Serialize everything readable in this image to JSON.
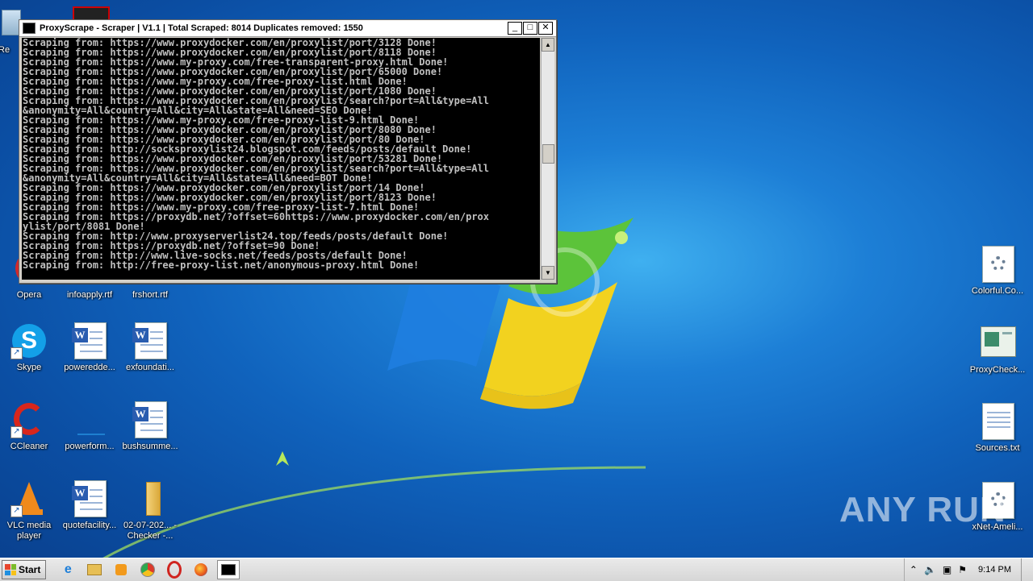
{
  "desktop": {
    "icons_left": [
      {
        "label": "Opera"
      },
      {
        "label": "infoapply.rtf"
      },
      {
        "label": "frshort.rtf"
      },
      {
        "label": "Skype"
      },
      {
        "label": "poweredde..."
      },
      {
        "label": "exfoundati..."
      },
      {
        "label": "CCleaner"
      },
      {
        "label": "powerform..."
      },
      {
        "label": "bushsumme..."
      },
      {
        "label": "VLC media player"
      },
      {
        "label": "quotefacility..."
      },
      {
        "label": "02-07-202... - Checker -..."
      }
    ],
    "icons_right": [
      {
        "label": "Colorful.Co..."
      },
      {
        "label": "ProxyCheck..."
      },
      {
        "label": "Sources.txt"
      },
      {
        "label": "xNet-Ameli..."
      }
    ],
    "partial_labels": {
      "top_left": "Re"
    }
  },
  "window": {
    "title": "ProxyScrape - Scraper | V1.1 | Total Scraped: 8014 Duplicates removed: 1550",
    "console_lines": [
      "Scraping from: https://www.proxydocker.com/en/proxylist/port/3128 Done!",
      "Scraping from: https://www.proxydocker.com/en/proxylist/port/8118 Done!",
      "Scraping from: https://www.my-proxy.com/free-transparent-proxy.html Done!",
      "Scraping from: https://www.proxydocker.com/en/proxylist/port/65000 Done!",
      "Scraping from: https://www.my-proxy.com/free-proxy-list.html Done!",
      "Scraping from: https://www.proxydocker.com/en/proxylist/port/1080 Done!",
      "Scraping from: https://www.proxydocker.com/en/proxylist/search?port=All&type=All",
      "&anonymity=All&country=All&city=All&state=All&need=SEO Done!",
      "Scraping from: https://www.my-proxy.com/free-proxy-list-9.html Done!",
      "Scraping from: https://www.proxydocker.com/en/proxylist/port/8080 Done!",
      "Scraping from: https://www.proxydocker.com/en/proxylist/port/80 Done!",
      "Scraping from: http://socksproxylist24.blogspot.com/feeds/posts/default Done!",
      "Scraping from: https://www.proxydocker.com/en/proxylist/port/53281 Done!",
      "Scraping from: https://www.proxydocker.com/en/proxylist/search?port=All&type=All",
      "&anonymity=All&country=All&city=All&state=All&need=BOT Done!",
      "Scraping from: https://www.proxydocker.com/en/proxylist/port/14 Done!",
      "Scraping from: https://www.proxydocker.com/en/proxylist/port/8123 Done!",
      "Scraping from: https://www.my-proxy.com/free-proxy-list-7.html Done!",
      "Scraping from: https://proxydb.net/?offset=60https://www.proxydocker.com/en/prox",
      "ylist/port/8081 Done!",
      "Scraping from: http://www.proxyserverlist24.top/feeds/posts/default Done!",
      "Scraping from: https://proxydb.net/?offset=90 Done!",
      "Scraping from: http://www.live-socks.net/feeds/posts/default Done!",
      "Scraping from: http://free-proxy-list.net/anonymous-proxy.html Done!"
    ],
    "buttons": {
      "minimize": "_",
      "maximize": "□",
      "close": "✕"
    }
  },
  "taskbar": {
    "start_label": "Start",
    "clock": "9:14 PM",
    "tray_icons": [
      "chevron-up-icon",
      "speaker-icon",
      "network-icon",
      "flag-icon"
    ]
  },
  "watermark": "ANY RUN"
}
